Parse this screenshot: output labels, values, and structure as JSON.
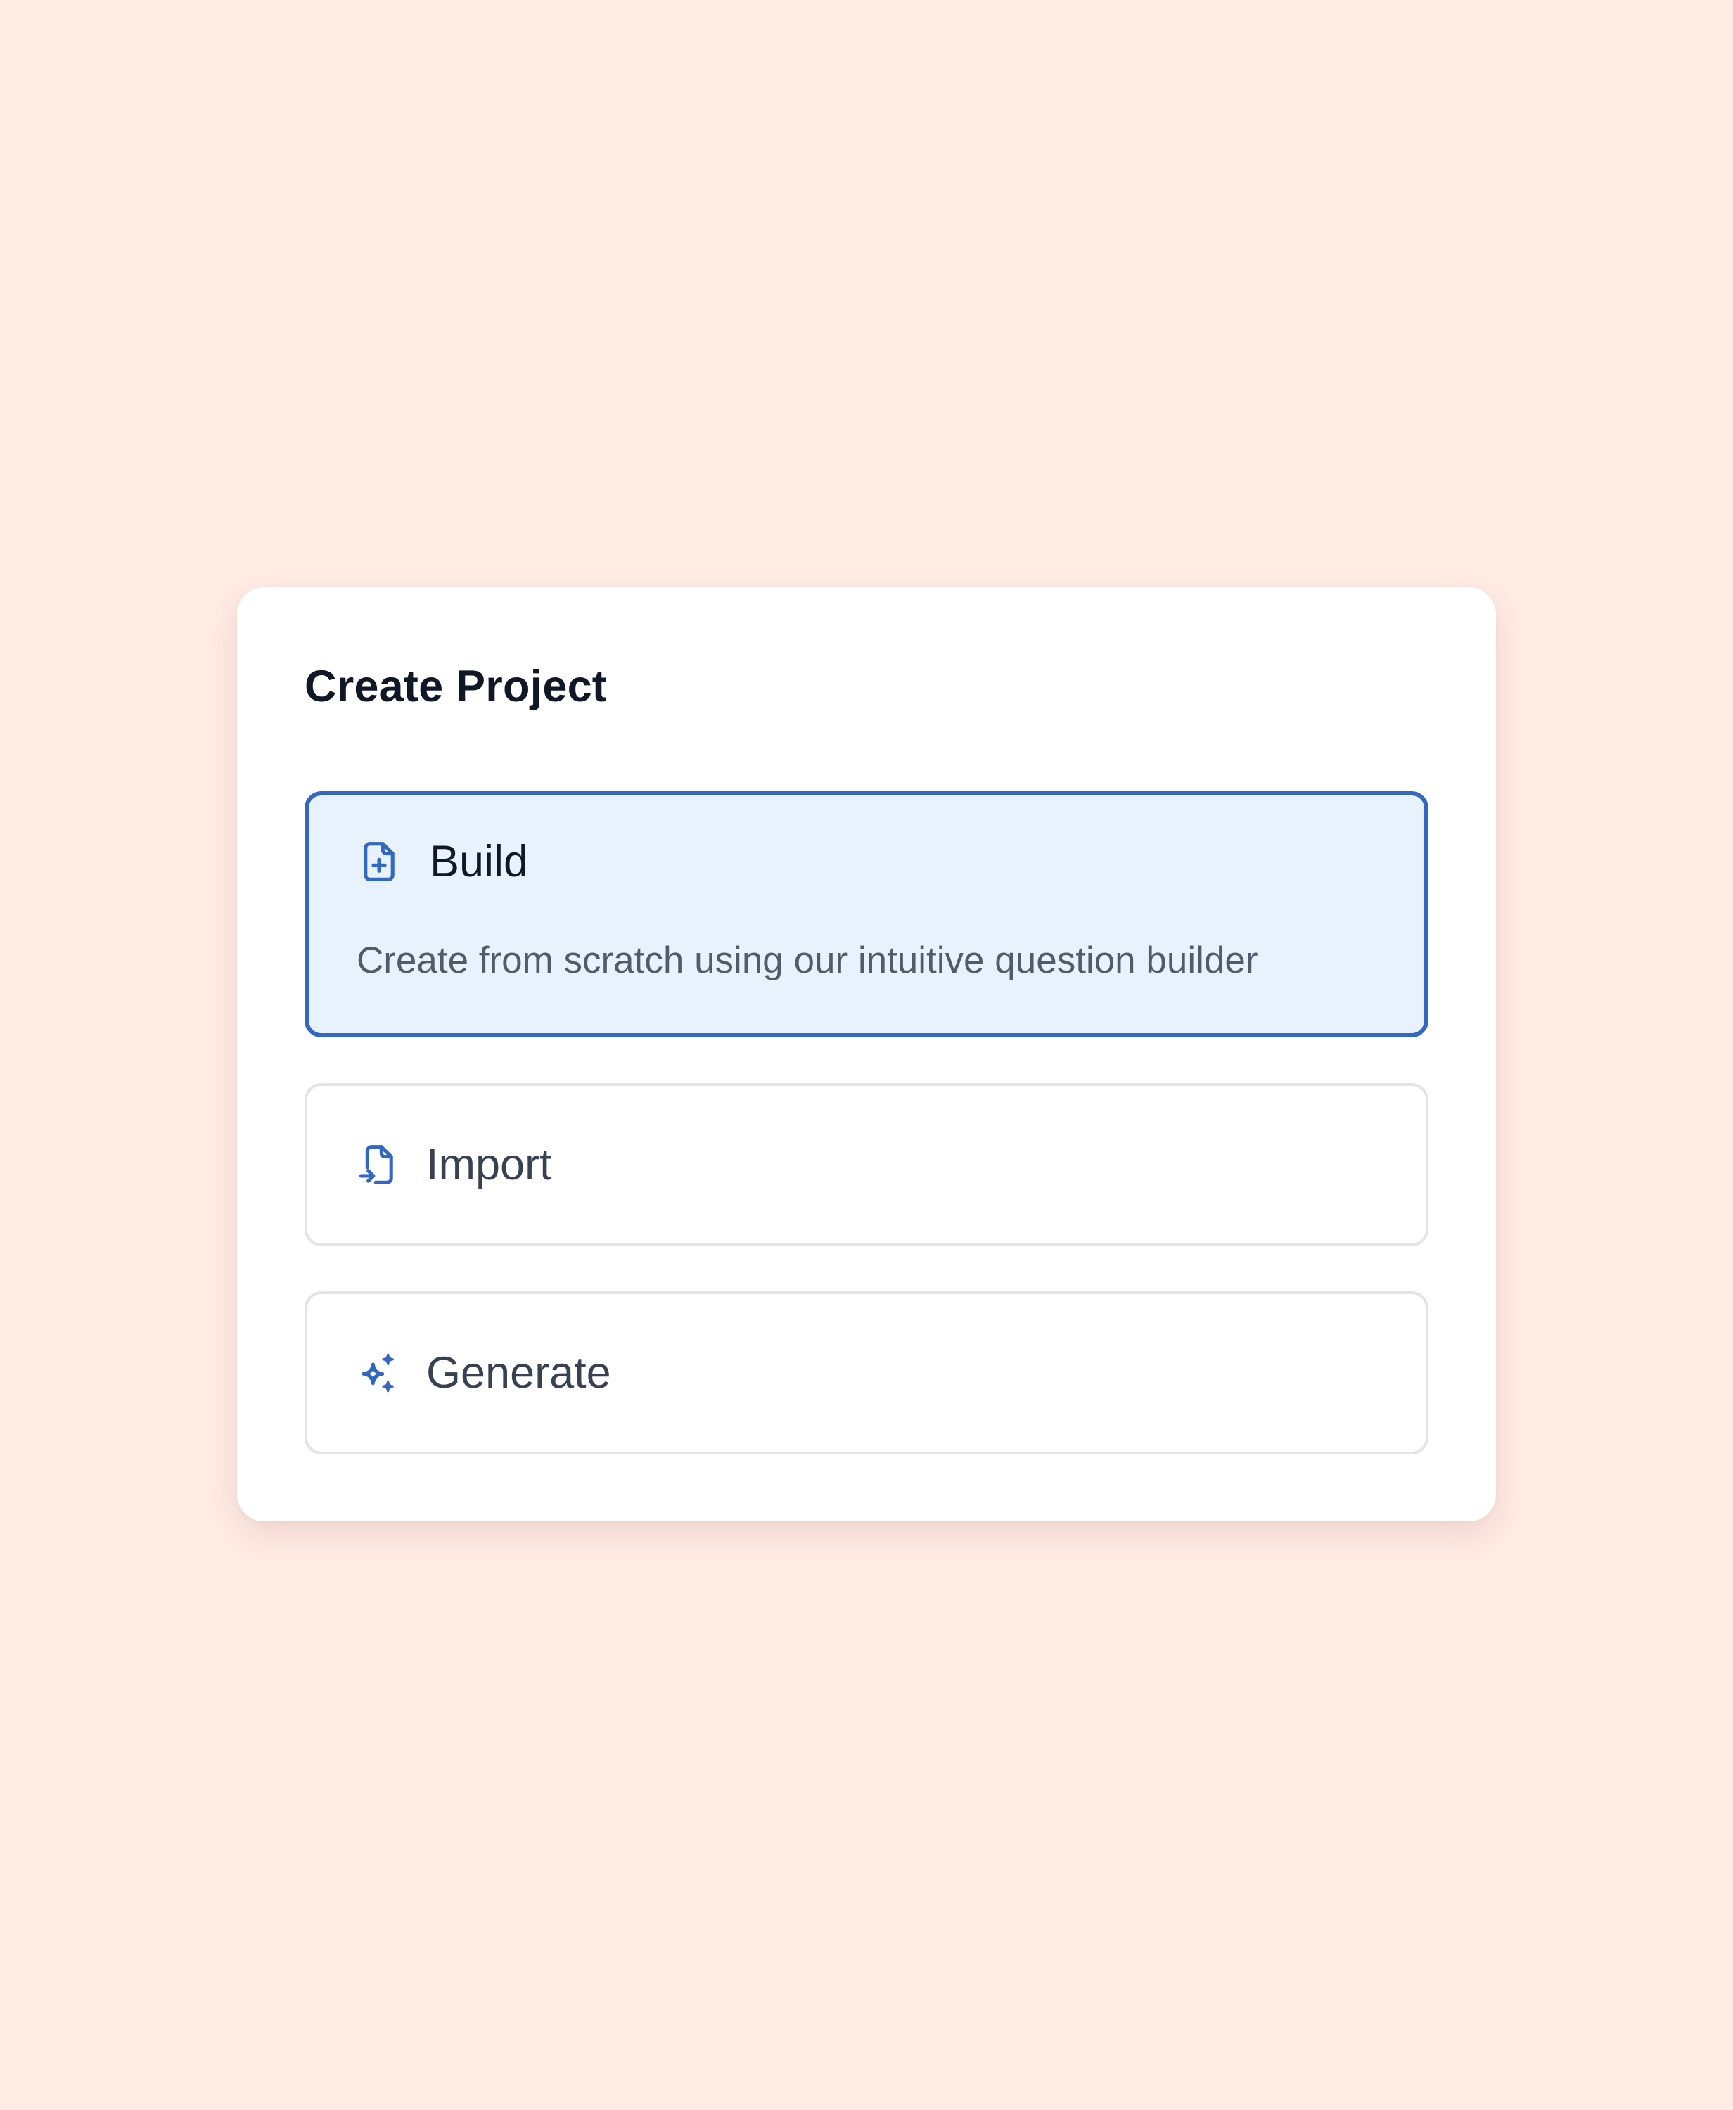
{
  "dialog": {
    "title": "Create Project",
    "options": [
      {
        "id": "build",
        "label": "Build",
        "description": "Create from scratch using our intuitive question builder",
        "icon": "file-plus-icon",
        "selected": true
      },
      {
        "id": "import",
        "label": "Import",
        "icon": "file-import-icon",
        "selected": false
      },
      {
        "id": "generate",
        "label": "Generate",
        "icon": "sparkles-icon",
        "selected": false
      }
    ]
  },
  "colors": {
    "background": "#ffece5",
    "card": "#ffffff",
    "accent": "#3268c1",
    "selected_fill": "#e8f2fd",
    "title_text": "#101828",
    "label_text": "#374151",
    "description_text": "#525b6b",
    "option_border": "#e4e4e7"
  }
}
